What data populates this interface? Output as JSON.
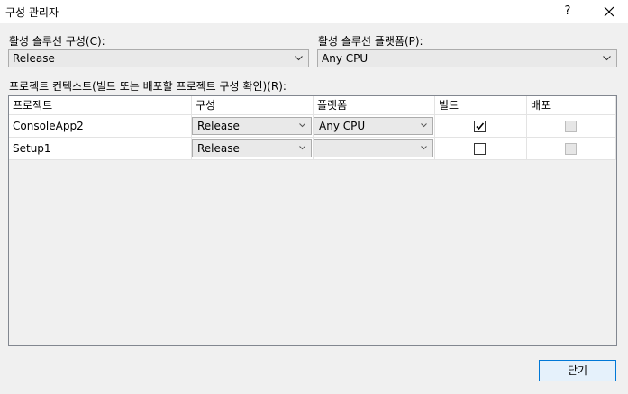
{
  "window": {
    "title": "구성 관리자",
    "help_label": "?"
  },
  "active_config": {
    "label": "활성 솔루션 구성(C):",
    "value": "Release"
  },
  "active_platform": {
    "label": "활성 솔루션 플랫폼(P):",
    "value": "Any CPU"
  },
  "contexts_label": "프로젝트 컨텍스트(빌드 또는 배포할 프로젝트 구성 확인)(R):",
  "columns": [
    "프로젝트",
    "구성",
    "플랫폼",
    "빌드",
    "배포"
  ],
  "rows": [
    {
      "project": "ConsoleApp2",
      "configuration": "Release",
      "platform": "Any CPU",
      "build": true,
      "deploy": false
    },
    {
      "project": "Setup1",
      "configuration": "Release",
      "platform": "",
      "build": false,
      "deploy": false
    }
  ],
  "close_button": "닫기"
}
